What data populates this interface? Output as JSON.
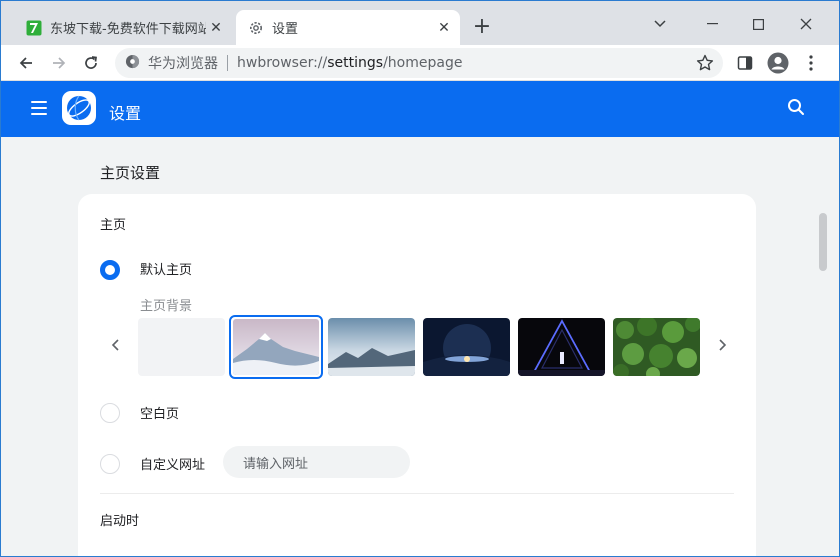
{
  "tabs": [
    {
      "title": "东坡下载-免费软件下载网站-绿",
      "favicon": "dongpo-favicon",
      "close": "✕"
    },
    {
      "title": "设置",
      "favicon": "gear-icon",
      "close": "✕"
    }
  ],
  "window_controls": {
    "minimize": "—",
    "maximize": "☐",
    "close": "✕",
    "tab_search": "⌄"
  },
  "new_tab": "+",
  "omnibox": {
    "site_name": "华为浏览器",
    "url_prefix": "hwbrowser://",
    "url_host": "settings",
    "url_path": "/homepage"
  },
  "appbar": {
    "title": "设置"
  },
  "page": {
    "section_title": "主页设置",
    "homepage_label": "主页",
    "options": [
      {
        "label": "默认主页",
        "selected": true
      },
      {
        "label": "空白页",
        "selected": false
      },
      {
        "label": "自定义网址",
        "selected": false
      }
    ],
    "background_label": "主页背景",
    "backgrounds": [
      {
        "name": "blank",
        "selected": false
      },
      {
        "name": "snow-mountain",
        "selected": true
      },
      {
        "name": "mountain-birds",
        "selected": false
      },
      {
        "name": "planet-space",
        "selected": false
      },
      {
        "name": "neon-triangle",
        "selected": false
      },
      {
        "name": "forest-aerial",
        "selected": false
      }
    ],
    "url_placeholder": "请输入网址",
    "startup_label": "启动时"
  },
  "colors": {
    "accent": "#0a6cf0",
    "appbar": "#0a6cf0"
  }
}
